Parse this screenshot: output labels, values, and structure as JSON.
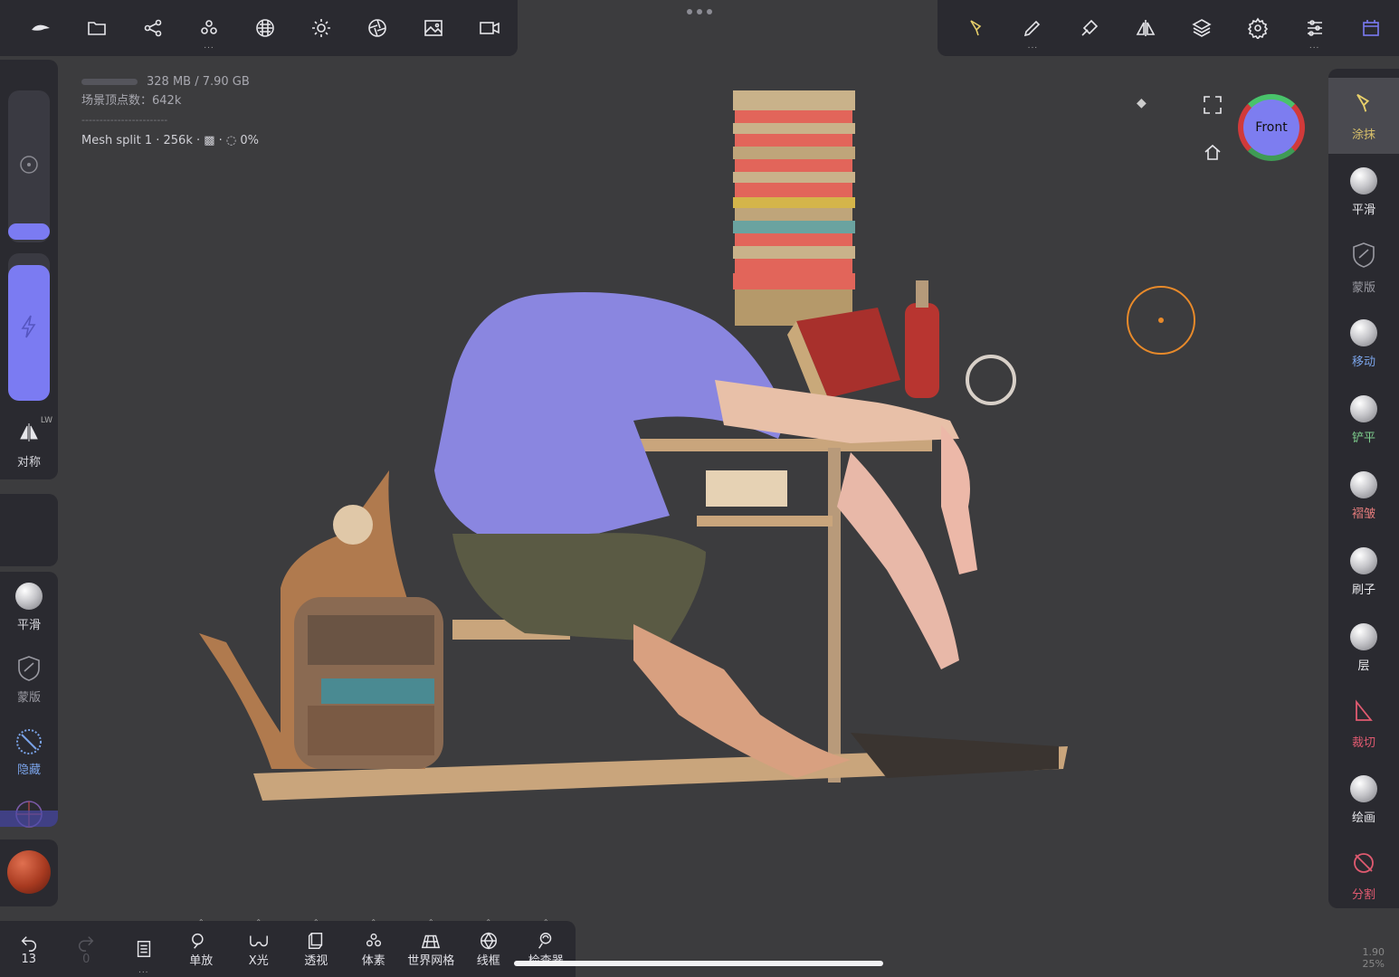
{
  "top_bar": {
    "left_tools": [
      "logo-icon",
      "folder-icon",
      "share-icon",
      "scene-icon",
      "material-icon",
      "light-icon",
      "camera-aperture-icon",
      "image-icon",
      "video-icon"
    ],
    "right_tools": [
      "paint-tool-icon",
      "brush-icon",
      "picker-icon",
      "symmetry-icon",
      "layers-icon",
      "settings-icon",
      "sliders-icon",
      "interface-icon"
    ]
  },
  "info": {
    "memory": "328 MB / 7.90 GB",
    "vertices": "场景顶点数：642k",
    "divider": "------------------------",
    "mesh": "Mesh split 1 · 256k · ▩ · ◌ 0%"
  },
  "view": {
    "navcube_label": "Front"
  },
  "left_panel": {
    "symmetry_label": "对称",
    "symmetry_sub": "LW",
    "smooth_label": "平滑",
    "mask_label": "蒙版",
    "hide_label": "隐藏"
  },
  "right_panel": {
    "tools": [
      {
        "label": "涂抹",
        "color": "#d8c06a",
        "icon": "paint-tool-icon",
        "active": true
      },
      {
        "label": "平滑",
        "color": "#e6e6ea",
        "icon": "smooth-ball-icon"
      },
      {
        "label": "蒙版",
        "color": "#9a9aa2",
        "icon": "mask-shield-icon"
      },
      {
        "label": "移动",
        "color": "#7aa3e8",
        "icon": "move-ball-icon"
      },
      {
        "label": "铲平",
        "color": "#7fcf8e",
        "icon": "flatten-ball-icon"
      },
      {
        "label": "褶皱",
        "color": "#e47c7c",
        "icon": "crease-ball-icon"
      },
      {
        "label": "刷子",
        "color": "#e6e6ea",
        "icon": "brush-ball-icon"
      },
      {
        "label": "层",
        "color": "#e6e6ea",
        "icon": "layer-ball-icon"
      },
      {
        "label": "裁切",
        "color": "#e05a70",
        "icon": "trim-icon"
      },
      {
        "label": "绘画",
        "color": "#e6e6ea",
        "icon": "paint-ball-icon"
      },
      {
        "label": "分割",
        "color": "#e05a70",
        "icon": "split-icon"
      }
    ]
  },
  "bottom_bar": {
    "undo_count": "13",
    "redo_count": "0",
    "items": [
      {
        "label": "单放",
        "icon": "search-icon"
      },
      {
        "label": "X光",
        "icon": "glasses-icon"
      },
      {
        "label": "透视",
        "icon": "perspective-icon"
      },
      {
        "label": "体素",
        "icon": "voxel-icon"
      },
      {
        "label": "世界网格",
        "icon": "grid-icon"
      },
      {
        "label": "线框",
        "icon": "wireframe-icon"
      },
      {
        "label": "检查器",
        "icon": "inspector-icon"
      }
    ]
  },
  "corner": {
    "line1": "1.90",
    "line2": "25%"
  }
}
